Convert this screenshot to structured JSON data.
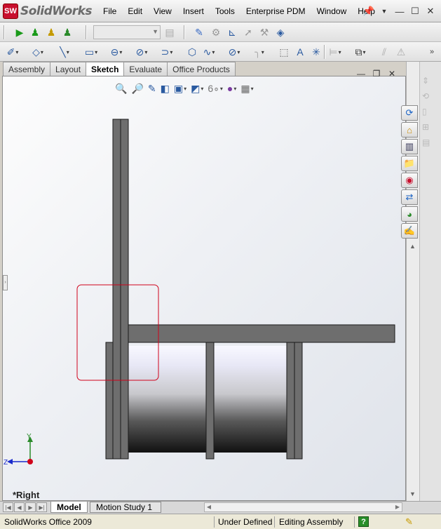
{
  "app": {
    "logo_badge": "SW",
    "logo_text": "SolidWorks"
  },
  "menu": [
    "File",
    "Edit",
    "View",
    "Insert",
    "Tools",
    "Enterprise PDM",
    "Window",
    "Help"
  ],
  "tabs": [
    "Assembly",
    "Layout",
    "Sketch",
    "Evaluate",
    "Office Products"
  ],
  "active_tab": "Sketch",
  "view_name": "*Right",
  "bottom_tabs": [
    "Model",
    "Motion Study 1"
  ],
  "status": {
    "product": "SolidWorks Office 2009",
    "state": "Under Defined",
    "mode": "Editing Assembly"
  },
  "triad": {
    "y_label": "Y",
    "z_label": "Z"
  },
  "colors": {
    "accent": "#c8102e",
    "selection_box": "#d0021b",
    "part_gray": "#6e6e6e"
  },
  "icons": {
    "toolbar1": [
      "green-play-icon",
      "user-green-icon",
      "user-yellow-icon",
      "user-check-icon",
      "edit-component-icon",
      "mate-icon",
      "smart-dimension-icon",
      "move-component-icon",
      "assembly-features-icon",
      "reference-geometry-icon"
    ],
    "toolbar2": [
      "sketch-icon",
      "smart-dimension-icon",
      "line-icon",
      "rectangle-icon",
      "slot-icon",
      "circle-icon",
      "arc-icon",
      "polygon-icon",
      "spline-icon",
      "ellipse-icon",
      "fillet-icon",
      "construction-geometry-icon",
      "text-icon",
      "point-icon",
      "mirror-icon",
      "offset-icon",
      "trim-icon",
      "relations-icon"
    ]
  }
}
